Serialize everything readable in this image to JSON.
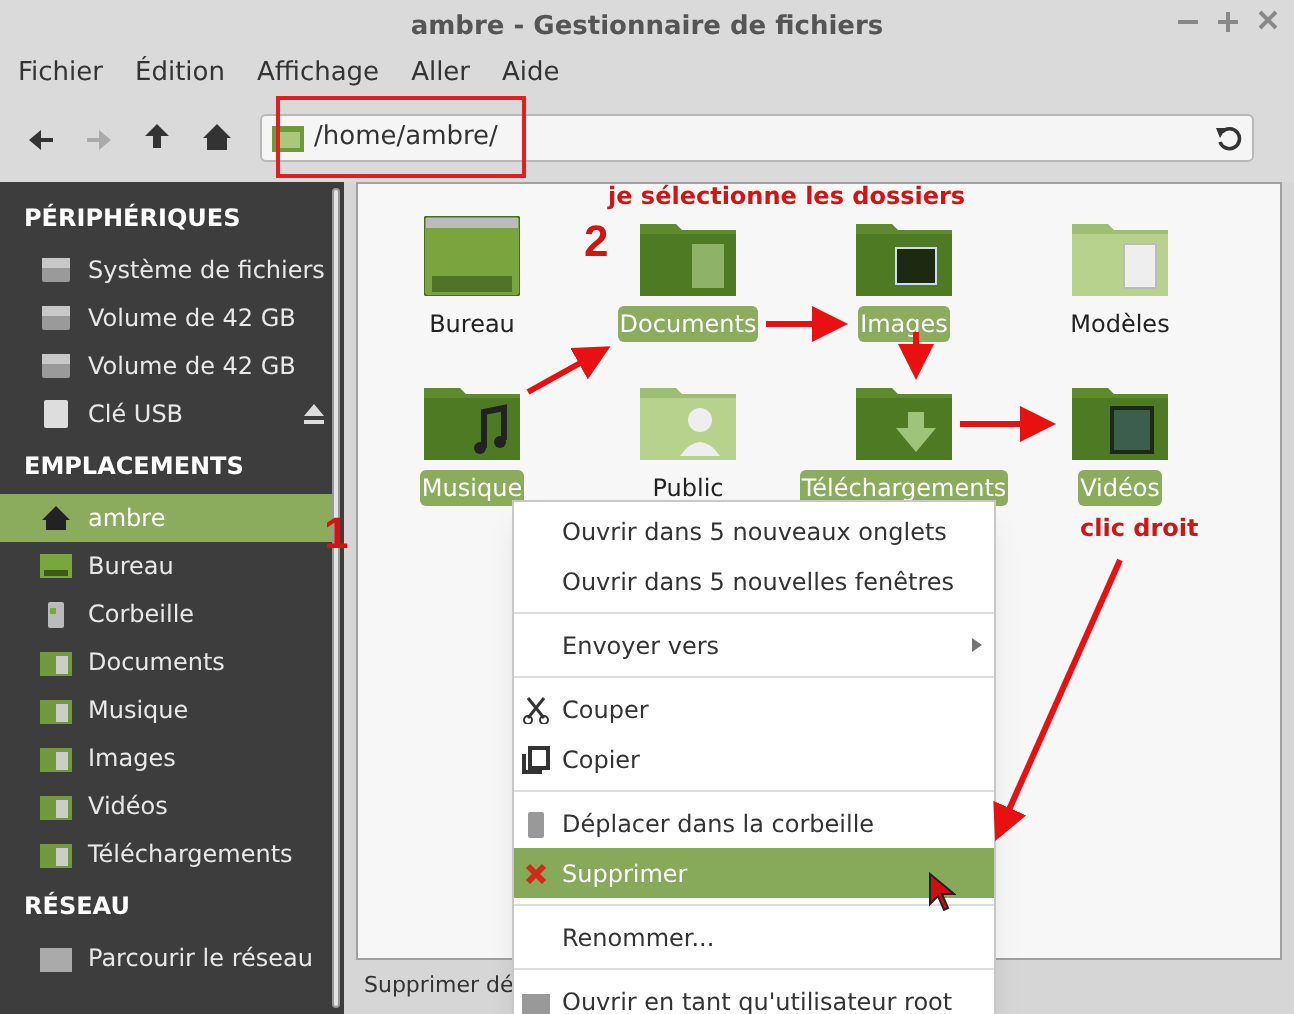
{
  "window": {
    "title": "ambre - Gestionnaire de fichiers"
  },
  "menu_bar": [
    "Fichier",
    "Édition",
    "Affichage",
    "Aller",
    "Aide"
  ],
  "toolbar": [
    {
      "kind": "back",
      "disabled": false
    },
    {
      "kind": "forward",
      "disabled": true
    },
    {
      "kind": "up",
      "disabled": false
    },
    {
      "kind": "home",
      "disabled": false
    }
  ],
  "path_bar": {
    "value": "/home/ambre/"
  },
  "sidebar": [
    {
      "heading": "PÉRIPHÉRIQUES",
      "items": [
        {
          "label": "Système de fichiers",
          "kind": "drive",
          "selected": false
        },
        {
          "label": "Volume de 42 GB",
          "kind": "drive",
          "selected": false
        },
        {
          "label": "Volume de 42 GB",
          "kind": "drive",
          "selected": false
        },
        {
          "label": "Clé USB",
          "kind": "usb",
          "selected": false,
          "ejectable": true
        }
      ]
    },
    {
      "heading": "EMPLACEMENTS",
      "items": [
        {
          "label": "ambre",
          "kind": "home",
          "selected": true
        },
        {
          "label": "Bureau",
          "kind": "desktop",
          "selected": false
        },
        {
          "label": "Corbeille",
          "kind": "trash",
          "selected": false
        },
        {
          "label": "Documents",
          "kind": "folder",
          "selected": false
        },
        {
          "label": "Musique",
          "kind": "folder",
          "selected": false
        },
        {
          "label": "Images",
          "kind": "folder",
          "selected": false
        },
        {
          "label": "Vidéos",
          "kind": "folder",
          "selected": false
        },
        {
          "label": "Téléchargements",
          "kind": "folder",
          "selected": false
        }
      ]
    },
    {
      "heading": "RÉSEAU",
      "items": [
        {
          "label": "Parcourir le réseau",
          "kind": "network",
          "selected": false
        }
      ]
    }
  ],
  "files": [
    {
      "name": "Bureau",
      "kind": "desktop",
      "selected": false
    },
    {
      "name": "Documents",
      "kind": "documents",
      "selected": true
    },
    {
      "name": "Images",
      "kind": "images",
      "selected": true
    },
    {
      "name": "Modèles",
      "kind": "templates",
      "selected": false
    },
    {
      "name": "Musique",
      "kind": "music",
      "selected": true
    },
    {
      "name": "Public",
      "kind": "public",
      "selected": false
    },
    {
      "name": "Téléchargements",
      "kind": "downloads",
      "selected": true
    },
    {
      "name": "Vidéos",
      "kind": "videos",
      "selected": true
    }
  ],
  "context_menu": [
    {
      "label": "Ouvrir dans 5 nouveaux onglets",
      "kind": "plain",
      "selected": false
    },
    {
      "label": "Ouvrir dans 5 nouvelles fenêtres",
      "kind": "plain",
      "selected": false
    },
    {
      "label": "Envoyer vers",
      "kind": "plain",
      "selected": false,
      "separator_before": true,
      "submenu": true
    },
    {
      "label": "Couper",
      "kind": "cut",
      "selected": false,
      "separator_before": true
    },
    {
      "label": "Copier",
      "kind": "copy",
      "selected": false
    },
    {
      "label": "Déplacer dans la corbeille",
      "kind": "trash",
      "selected": false,
      "separator_before": true
    },
    {
      "label": "Supprimer",
      "kind": "delete",
      "selected": true
    },
    {
      "label": "Renommer...",
      "kind": "plain",
      "selected": false,
      "separator_before": true
    },
    {
      "label": "Ouvrir en tant qu'utilisateur root",
      "kind": "folder",
      "selected": false,
      "separator_before": true
    }
  ],
  "status_bar": "Supprimer dé",
  "annotations": [
    {
      "kind": "caption",
      "text": "je sélectionne les dossiers"
    },
    {
      "kind": "step",
      "text": "2"
    },
    {
      "kind": "step",
      "text": "1"
    },
    {
      "kind": "caption",
      "text": "clic droit"
    }
  ]
}
